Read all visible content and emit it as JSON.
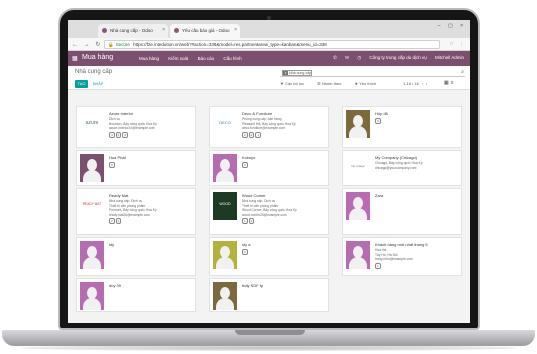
{
  "browser": {
    "tabs": [
      {
        "label": "Nhà cung cấp - Odoo"
      },
      {
        "label": "Yêu cầu báo giá - Odoo"
      }
    ],
    "url_secure": "Secure",
    "url": "https://f2e.intedution.vn/web?#action=338&model=res.partner&view_type=kanban&menu_id=338"
  },
  "topnav": {
    "app": "Mua hàng",
    "menu": [
      "Mua hàng",
      "Kiểm soát",
      "Báo cáo",
      "Cấu hình"
    ],
    "company": "Công ty trung cấp du dịch vụ",
    "user": "Mitchell Admin"
  },
  "cpanel": {
    "breadcrumb": "Nhà cung cấp",
    "create": "TẠO",
    "import": "NHẬP",
    "facet": "Nhà cung cấp",
    "filters": [
      "Các bộ lọc",
      "Nhóm theo",
      "Yêu thích"
    ],
    "pager": "1-16 / 16"
  },
  "cards": [
    {
      "name": "Azure Interior",
      "thumb": "logo",
      "logo": "azure",
      "lines": [
        "Dịch vụ",
        "Bourdon, Bảy cộng quốc Hoa Kỳ",
        "azure.Interior24@example.com"
      ],
      "badges": [
        "4",
        "0",
        "2"
      ]
    },
    {
      "name": "Deco & Furniture",
      "thumb": "logo",
      "logo": "deco",
      "lines": [
        "Phòng cung cấp, bán hàng",
        "Pleasant Hill, Bảy cộng quốc Hoa Kỳ",
        "deco.furniture@example.com"
      ],
      "badges": [
        "2",
        "2",
        "1"
      ]
    },
    {
      "name": "Hộp đỏ",
      "thumb": "avatar",
      "lines": [],
      "badges": [
        "0"
      ]
    },
    {
      "name": "Hoa Phát",
      "thumb": "avatar",
      "lines": [],
      "badges": [
        "0"
      ]
    },
    {
      "name": "Kokoyo",
      "thumb": "avatar",
      "lines": [],
      "badges": [
        "0"
      ]
    },
    {
      "name": "My Company (Chicago)",
      "thumb": "logo",
      "logo": "no-image",
      "lines": [
        "Chicago, Bảy cộng quốc Hoa Kỳ",
        "chicago@yourcompany.com"
      ],
      "badges": []
    },
    {
      "name": "Ready Mat",
      "thumb": "logo",
      "logo": "ready",
      "lines": [
        "Nhà cung cấp, Dịch vụ",
        "Thiết bị văn phòng phẩm",
        "Fremont, Bảy cộng quốc Hoa Kỳ",
        "ready.mat28@example.com"
      ],
      "badges": [
        "2",
        "1"
      ]
    },
    {
      "name": "Wood Corner",
      "thumb": "logo",
      "logo": "wood",
      "lines": [
        "Nhà cung cấp, Dịch vụ",
        "Thiết bị văn phòng phẩm",
        "Wood Corner, Bảy cộng quốc Hoa Kỳ",
        "wood.corner26@example.com"
      ],
      "badges": [
        "1",
        "1"
      ]
    },
    {
      "name": "Zara",
      "thumb": "avatar",
      "lines": [],
      "badges": []
    },
    {
      "name": "sty",
      "thumb": "avatar",
      "lines": [],
      "badges": []
    },
    {
      "name": "sty a",
      "thumb": "avatar",
      "lines": [],
      "badges": [
        "0"
      ]
    },
    {
      "name": "Khách hàng mới nhất tháng 5",
      "thumb": "avatar",
      "lines": [
        "Hoa Hà",
        "Tây Hồ, Hà Nội",
        "trang.nhtn@example.com"
      ],
      "badges": [
        "1"
      ]
    },
    {
      "name": "duy 39",
      "thumb": "avatar",
      "lines": [],
      "badges": []
    },
    {
      "name": "thấy SDF fp",
      "thumb": "avatar",
      "lines": [],
      "badges": []
    }
  ],
  "colors": {
    "odoo_purple": "#7c4f6e",
    "teal": "#00a09d"
  }
}
